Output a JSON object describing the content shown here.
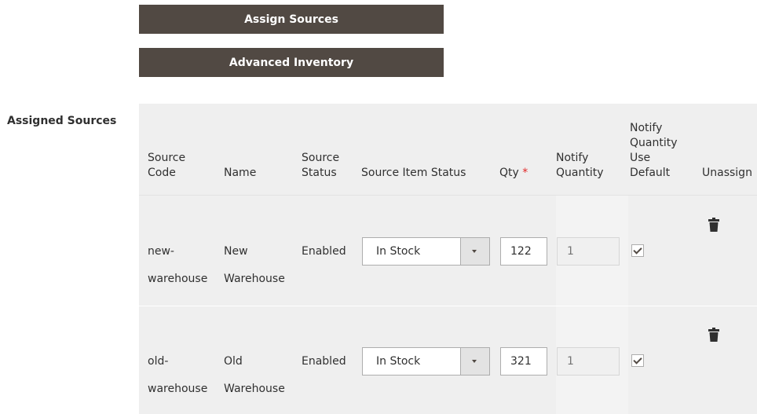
{
  "actions": {
    "assign_sources": "Assign Sources",
    "advanced_inventory": "Advanced Inventory"
  },
  "section": {
    "label": "Assigned Sources"
  },
  "table": {
    "headers": {
      "source_code_1": "Source",
      "source_code_2": "Code",
      "name": "Name",
      "source_status_1": "Source",
      "source_status_2": "Status",
      "source_item_status": "Source Item Status",
      "qty": "Qty",
      "qty_required": "*",
      "notify_quantity_1": "Notify",
      "notify_quantity_2": "Quantity",
      "nq_default_1": "Notify",
      "nq_default_2": "Quantity",
      "nq_default_3": "Use",
      "nq_default_4": "Default",
      "unassign": "Unassign"
    },
    "rows": [
      {
        "code_1": "new-",
        "code_2": "warehouse",
        "name_1": "New",
        "name_2": "Warehouse",
        "status": "Enabled",
        "item_status": "In Stock",
        "qty": "122",
        "notify_qty": "1",
        "use_default": true
      },
      {
        "code_1": "old-",
        "code_2": "warehouse",
        "name_1": "Old",
        "name_2": "Warehouse",
        "status": "Enabled",
        "item_status": "In Stock",
        "qty": "321",
        "notify_qty": "1",
        "use_default": true
      }
    ]
  },
  "icons": {
    "unassign": "trash-icon",
    "dropdown": "chevron-down-icon",
    "checkbox": "checkmark-icon"
  },
  "colors": {
    "button_bg": "#514943",
    "grid_bg": "#efefef",
    "required": "#e22626"
  }
}
